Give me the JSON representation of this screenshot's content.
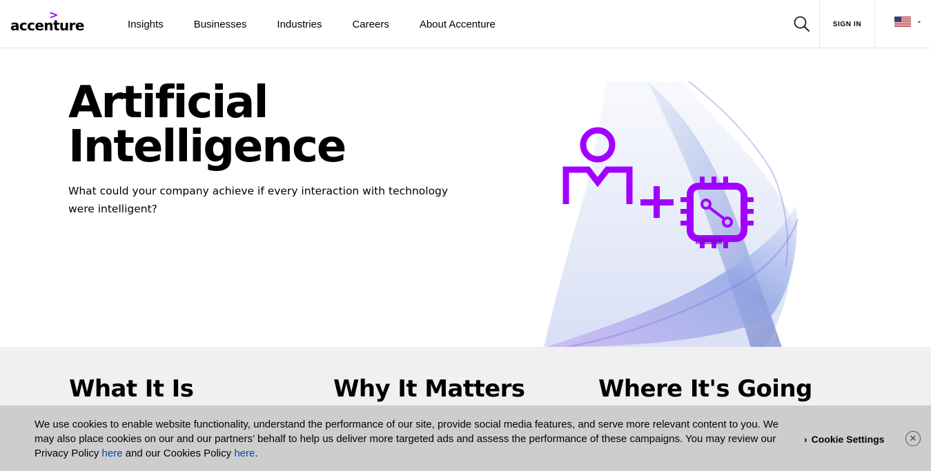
{
  "header": {
    "logo_arrow": ">",
    "logo_text": "accenture",
    "nav": [
      "Insights",
      "Businesses",
      "Industries",
      "Careers",
      "About Accenture"
    ],
    "search_icon": "search-icon",
    "signin_label": "SIGN IN",
    "locale_icon": "us-flag-icon"
  },
  "hero": {
    "title_line1": "Artificial",
    "title_line2": "Intelligence",
    "subtitle": "What could your company achieve if every interaction with technology were intelligent?",
    "art_icon": "person-plus-chip-icon"
  },
  "sections": {
    "col1": "What It Is",
    "col2": "Why It Matters",
    "col3": "Where It's Going"
  },
  "cookie": {
    "text_before": "We use cookies to enable website functionality, understand the performance of our site, provide social media features, and serve more relevant content to you. We may also place cookies on our and our partners’ behalf to help us deliver more targeted ads and assess the performance of these campaigns. You may review our Privacy Policy ",
    "link1": "here",
    "text_middle": " and our Cookies Policy ",
    "link2": "here",
    "text_end": ".",
    "settings_label": "Cookie Settings",
    "close_icon": "close-icon"
  },
  "colors": {
    "brand_purple": "#a100ff",
    "cookie_bg": "#cdcdcd",
    "section_bg": "#f0f0f0",
    "link": "#0645ad"
  }
}
